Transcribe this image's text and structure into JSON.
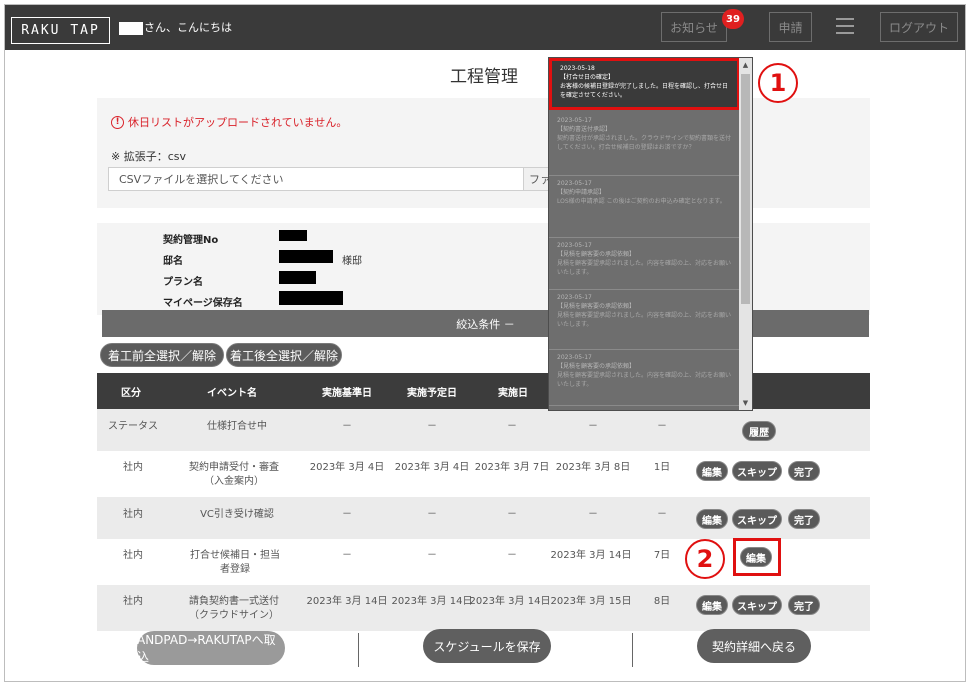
{
  "header": {
    "logo": "RAKU TAP",
    "greeting": "さん、こんにちは",
    "notice_label": "お知らせ",
    "notice_count": "39",
    "apply_label": "申請",
    "logout_label": "ログアウト"
  },
  "page_title": "工程管理",
  "upload": {
    "warning": "休日リストがアップロードされていません。",
    "warning_icon_text": "!",
    "ext_label": "※ 拡張子：csv",
    "placeholder": "CSVファイルを選択してください",
    "file_button": "ファイル選択"
  },
  "info": {
    "contract_no_label": "契約管理No",
    "house_label": "邸名",
    "house_suffix": "様邸",
    "plan_label": "プラン名",
    "mypage_label": "マイページ保存名"
  },
  "filter_label": "絞込条件 －",
  "bulk": {
    "before_label": "着工前全選択／解除",
    "after_label": "着工後全選択／解除"
  },
  "table": {
    "headers": [
      "区分",
      "イベント名",
      "実施基準日",
      "実施予定日",
      "実施日"
    ],
    "rows": [
      {
        "category": "ステータス",
        "event": "仕様打合せ中",
        "base": "－",
        "planned": "－",
        "actual": "－",
        "date4": "－",
        "days": "－",
        "actions": [
          "履歴"
        ]
      },
      {
        "category": "社内",
        "event": "契約申請受付・審査（入金案内）",
        "base": "2023年 3月 4日",
        "planned": "2023年 3月 4日",
        "actual": "2023年 3月 7日",
        "date4": "2023年 3月 8日",
        "days": "1日",
        "actions": [
          "編集",
          "スキップ",
          "完了"
        ]
      },
      {
        "category": "社内",
        "event": "VC引き受け確認",
        "base": "－",
        "planned": "－",
        "actual": "－",
        "date4": "－",
        "days": "－",
        "actions": [
          "編集",
          "スキップ",
          "完了"
        ]
      },
      {
        "category": "社内",
        "event": "打合せ候補日・担当者登録",
        "base": "－",
        "planned": "－",
        "actual": "－",
        "date4": "2023年 3月 14日",
        "days": "7日",
        "actions": [
          "編集"
        ]
      },
      {
        "category": "社内",
        "event": "請負契約書一式送付（クラウドサイン）",
        "base": "2023年 3月 14日",
        "planned": "2023年 3月 14日",
        "actual": "2023年 3月 14日",
        "date4": "2023年 3月 15日",
        "days": "8日",
        "actions": [
          "編集",
          "スキップ",
          "完了"
        ]
      }
    ]
  },
  "footer": {
    "andpad_label": "ANDPAD→RAKUTAPへ取込",
    "save_label": "スケジュールを保存",
    "back_label": "契約詳細へ戻る"
  },
  "notifications": [
    {
      "date": "2023-05-18",
      "title": "【打合せ日の確定】",
      "body": "お客様の候補日登録が完了しました。日程を確認し、打合せ日を確定させてください。"
    },
    {
      "date": "2023-05-17",
      "title": "【契約書送付承認】",
      "body": "契約書送付が承認されました。クラウドサインで契約書類を送付してください。打合せ候補日の登録はお済ですか？"
    },
    {
      "date": "2023-05-17",
      "title": "【契約申請承認】",
      "body": "LOS様の申請承認 この後はご契約のお申込み確定となります。"
    },
    {
      "date": "2023-05-17",
      "title": "【見積を顧客要の承認依頼】",
      "body": "見積を顧客要望承認されました。内容を確認の上、対応をお願いいたします。"
    },
    {
      "date": "2023-05-17",
      "title": "【見積を顧客要の承認依頼】",
      "body": "見積を顧客要望承認されました。内容を確認の上、対応をお願いいたします。"
    },
    {
      "date": "2023-05-17",
      "title": "【見積を顧客要の承認依頼】",
      "body": "見積を顧客要望承認されました。内容を確認の上、対応をお願いいたします。"
    }
  ],
  "callouts": {
    "one": "1",
    "two": "2"
  }
}
